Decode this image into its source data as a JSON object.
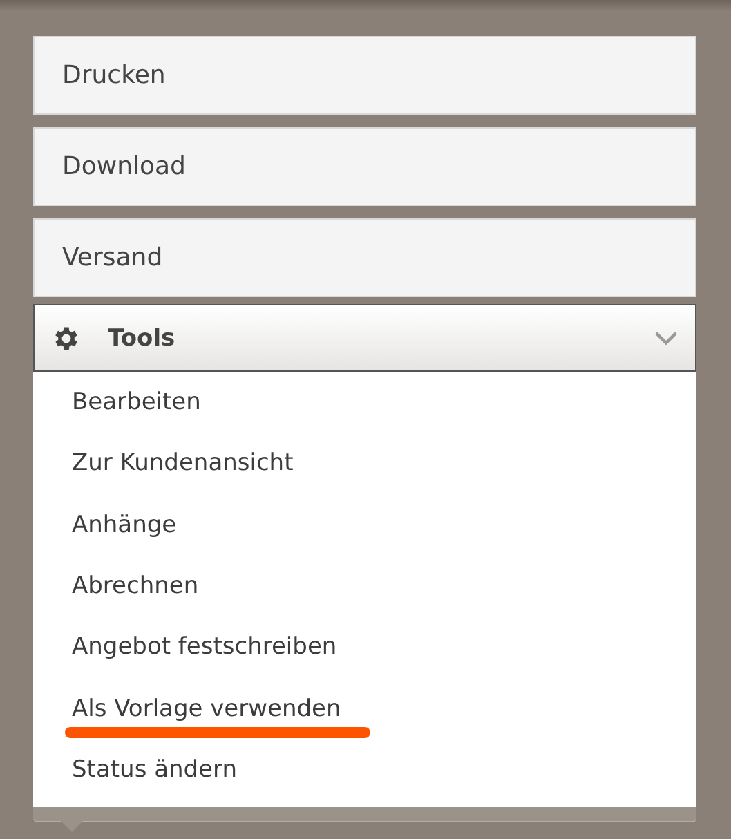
{
  "buttons": [
    "Drucken",
    "Download",
    "Versand"
  ],
  "tools": {
    "label": "Tools",
    "expanded": true
  },
  "menu_items": [
    {
      "label": "Bearbeiten",
      "highlighted": false
    },
    {
      "label": "Zur Kundenansicht",
      "highlighted": false
    },
    {
      "label": "Anhänge",
      "highlighted": false
    },
    {
      "label": "Abrechnen",
      "highlighted": false
    },
    {
      "label": "Angebot festschreiben",
      "highlighted": false
    },
    {
      "label": "Als Vorlage verwenden",
      "highlighted": true
    },
    {
      "label": "Status ändern",
      "highlighted": false
    }
  ]
}
